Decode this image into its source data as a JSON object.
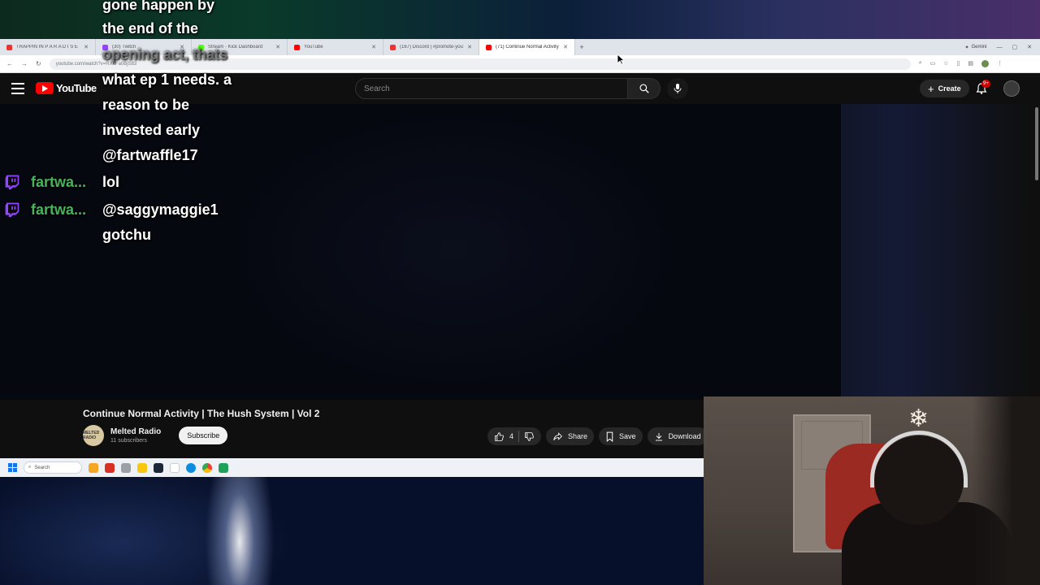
{
  "browser": {
    "tabs": [
      {
        "label": "TRAPPIN IN P A R A D I S E",
        "color": "#e33"
      },
      {
        "label": "(30) Twitch",
        "color": "#9146ff"
      },
      {
        "label": "Stream - Kick Dashboard",
        "color": "#53fc18"
      },
      {
        "label": "YouTube",
        "color": "#ff0000"
      },
      {
        "label": "(167) Discord | #promote-your...",
        "color": "#e33"
      },
      {
        "label": "(71) Continue Normal Activity",
        "color": "#ff0000"
      }
    ],
    "gemini_label": "Gemini",
    "url": "youtube.com/watch?v=RXuFa0BjS83"
  },
  "youtube": {
    "logo_text": "YouTube",
    "search_placeholder": "Search",
    "create_label": "Create",
    "notification_badge": "9+",
    "video": {
      "title": "Continue Normal Activity | The Hush System | Vol 2",
      "channel_name": "Melted Radio",
      "channel_avatar_text": "MELTED RADIO",
      "subscribers": "11 subscribers",
      "subscribe_label": "Subscribe",
      "likes": "4",
      "share_label": "Share",
      "save_label": "Save",
      "download_label": "Download"
    }
  },
  "taskbar": {
    "search_label": "Search"
  },
  "chat": {
    "lines": [
      {
        "text": "gone happen by"
      },
      {
        "text": "the end of the"
      },
      {
        "text": "opening act, thats"
      },
      {
        "text": "what ep 1 needs. a"
      },
      {
        "text": "reason to be"
      },
      {
        "text": "invested early"
      },
      {
        "text": "@fartwaffle17"
      }
    ],
    "messages": [
      {
        "user": "fartwa...",
        "text": "lol"
      },
      {
        "user": "fartwa...",
        "text": "@saggymaggie1"
      },
      {
        "user": "",
        "text": "gotchu"
      }
    ]
  },
  "colors": {
    "youtube_bg": "#0f0f0f",
    "youtube_red": "#ff0000",
    "twitch_purple": "#9146ff",
    "chat_username": "#48b35b"
  }
}
